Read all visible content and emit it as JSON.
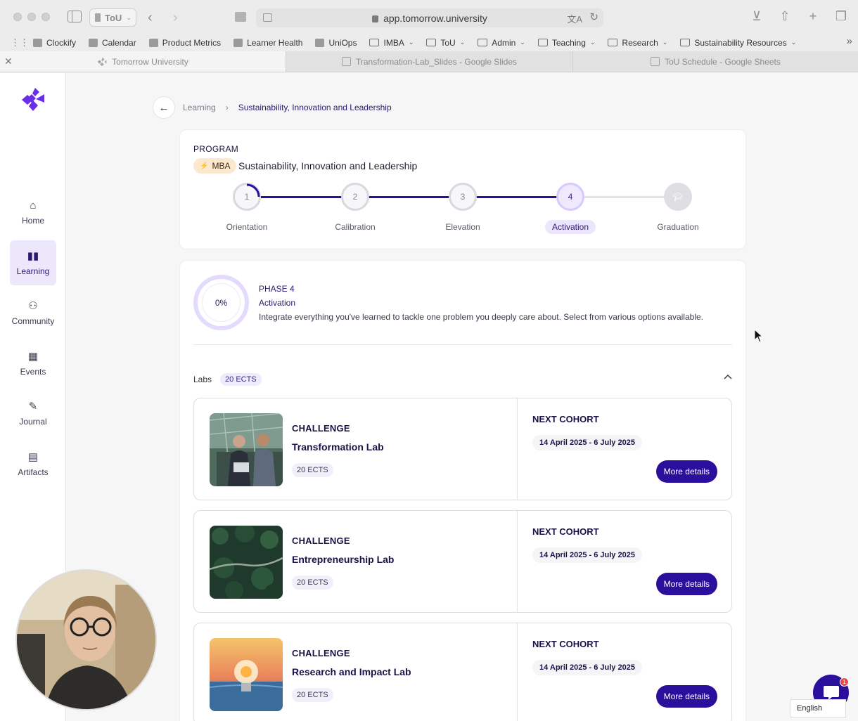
{
  "browser": {
    "tab_group_label": "ToU",
    "url": "app.tomorrow.university",
    "bookmarks": [
      {
        "label": "Clockify",
        "icon": "clockify-icon",
        "folder": false
      },
      {
        "label": "Calendar",
        "icon": "calendar-icon",
        "folder": false
      },
      {
        "label": "Product Metrics",
        "icon": "metrics-icon",
        "folder": false
      },
      {
        "label": "Learner Health",
        "icon": "google-icon",
        "folder": false
      },
      {
        "label": "UniOps",
        "icon": "tou-icon",
        "folder": false
      },
      {
        "label": "IMBA",
        "icon": "folder-icon",
        "folder": true
      },
      {
        "label": "ToU",
        "icon": "folder-icon",
        "folder": true
      },
      {
        "label": "Admin",
        "icon": "folder-icon",
        "folder": true
      },
      {
        "label": "Teaching",
        "icon": "folder-icon",
        "folder": true
      },
      {
        "label": "Research",
        "icon": "folder-icon",
        "folder": true
      },
      {
        "label": "Sustainability Resources",
        "icon": "folder-icon",
        "folder": true
      }
    ],
    "tabs": [
      {
        "title": "Tomorrow University",
        "active": true
      },
      {
        "title": "Transformation-Lab_Slides - Google Slides",
        "active": false
      },
      {
        "title": "ToU Schedule - Google Sheets",
        "active": false
      }
    ]
  },
  "sidebar": {
    "items": [
      {
        "label": "Home",
        "icon": "home-icon",
        "active": false
      },
      {
        "label": "Learning",
        "icon": "book-icon",
        "active": true
      },
      {
        "label": "Community",
        "icon": "people-icon",
        "active": false
      },
      {
        "label": "Events",
        "icon": "calendar-icon",
        "active": false
      },
      {
        "label": "Journal",
        "icon": "journal-icon",
        "active": false
      },
      {
        "label": "Artifacts",
        "icon": "artifact-icon",
        "active": false
      }
    ]
  },
  "breadcrumb": {
    "parent": "Learning",
    "current": "Sustainability, Innovation and Leadership"
  },
  "program": {
    "label": "PROGRAM",
    "badge": "MBA",
    "title": "Sustainability, Innovation and Leadership",
    "steps": [
      {
        "number": "1",
        "label": "Orientation",
        "state": "done"
      },
      {
        "number": "2",
        "label": "Calibration",
        "state": "done"
      },
      {
        "number": "3",
        "label": "Elevation",
        "state": "done"
      },
      {
        "number": "4",
        "label": "Activation",
        "state": "current"
      },
      {
        "number": "",
        "label": "Graduation",
        "state": "upcoming"
      }
    ]
  },
  "phase": {
    "progress": "0%",
    "number_label": "PHASE 4",
    "name": "Activation",
    "description": "Integrate everything you've learned to tackle one problem you deeply care about. Select from various options available."
  },
  "labs": {
    "heading": "Labs",
    "ects": "20 ECTS",
    "items": [
      {
        "kicker": "CHALLENGE",
        "title": "Transformation Lab",
        "ects": "20 ECTS",
        "next_label": "NEXT COHORT",
        "dates": "14 April 2025 - 6 July 2025",
        "button": "More details"
      },
      {
        "kicker": "CHALLENGE",
        "title": "Entrepreneurship Lab",
        "ects": "20 ECTS",
        "next_label": "NEXT COHORT",
        "dates": "14 April 2025 - 6 July 2025",
        "button": "More details"
      },
      {
        "kicker": "CHALLENGE",
        "title": "Research and Impact Lab",
        "ects": "20 ECTS",
        "next_label": "NEXT COHORT",
        "dates": "14 April 2025 - 6 July 2025",
        "button": "More details"
      }
    ]
  },
  "chat": {
    "badge": "1"
  },
  "language": {
    "selected": "English"
  },
  "colors": {
    "brand": "#2a0e9c",
    "accent_light": "#ece7fb",
    "logo": "#6b2ee8"
  }
}
